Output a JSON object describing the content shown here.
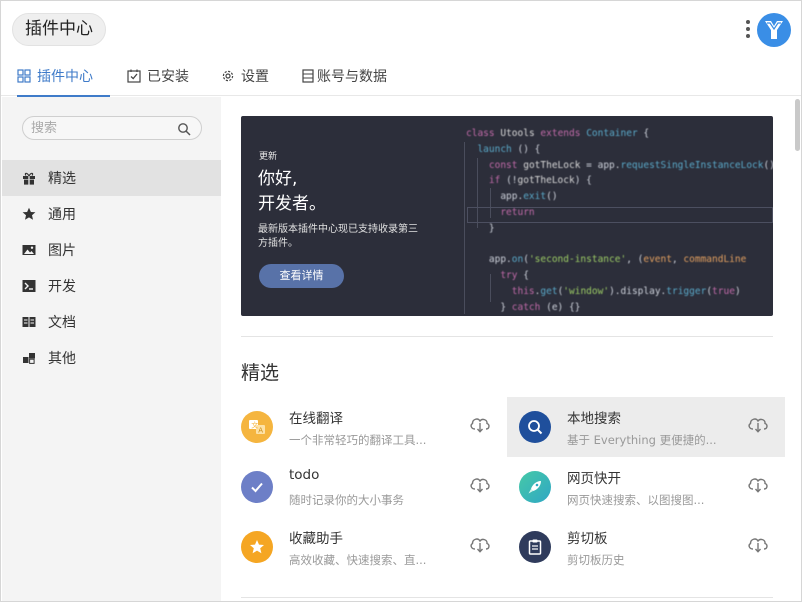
{
  "header": {
    "title": "插件中心"
  },
  "tabs": [
    {
      "label": "插件中心",
      "icon": "grid-icon"
    },
    {
      "label": "已安装",
      "icon": "checkbox-icon"
    },
    {
      "label": "设置",
      "icon": "gear-icon"
    },
    {
      "label": "账号与数据",
      "icon": "database-icon"
    }
  ],
  "search": {
    "placeholder": "搜索",
    "value": ""
  },
  "sidebar": {
    "items": [
      {
        "label": "精选",
        "icon": "gift-icon"
      },
      {
        "label": "通用",
        "icon": "star-icon"
      },
      {
        "label": "图片",
        "icon": "image-icon"
      },
      {
        "label": "开发",
        "icon": "terminal-icon"
      },
      {
        "label": "文档",
        "icon": "book-icon"
      },
      {
        "label": "其他",
        "icon": "blocks-icon"
      }
    ]
  },
  "banner": {
    "tag": "更新",
    "headline_1": "你好,",
    "headline_2": "开发者。",
    "desc": "最新版本插件中心现已支持收录第三方插件。",
    "button": "查看详情"
  },
  "section": {
    "title": "精选"
  },
  "plugins": [
    {
      "name": "在线翻译",
      "desc": "一个非常轻巧的翻译工具...",
      "icon": "translate-icon",
      "color": "#f5b53f"
    },
    {
      "name": "本地搜索",
      "desc": "基于 Everything 更便捷的...",
      "icon": "search-icon",
      "color": "#1f4f9c"
    },
    {
      "name": "todo",
      "desc": "随时记录你的大小事务",
      "icon": "check-icon",
      "color": "#6d7fc7"
    },
    {
      "name": "网页快开",
      "desc": "网页快速搜索、以图搜图...",
      "icon": "rocket-icon",
      "color": "#3fbf9a"
    },
    {
      "name": "收藏助手",
      "desc": "高效收藏、快速搜索、直...",
      "icon": "star-icon",
      "color": "#f5a623"
    },
    {
      "name": "剪切板",
      "desc": "剪切板历史",
      "icon": "clipboard-icon",
      "color": "#2f3b5c"
    }
  ],
  "colors": {
    "accent": "#3f7bc9",
    "sidebar_bg": "#f4f4f4",
    "banner_bg": "#2c2e3a"
  }
}
